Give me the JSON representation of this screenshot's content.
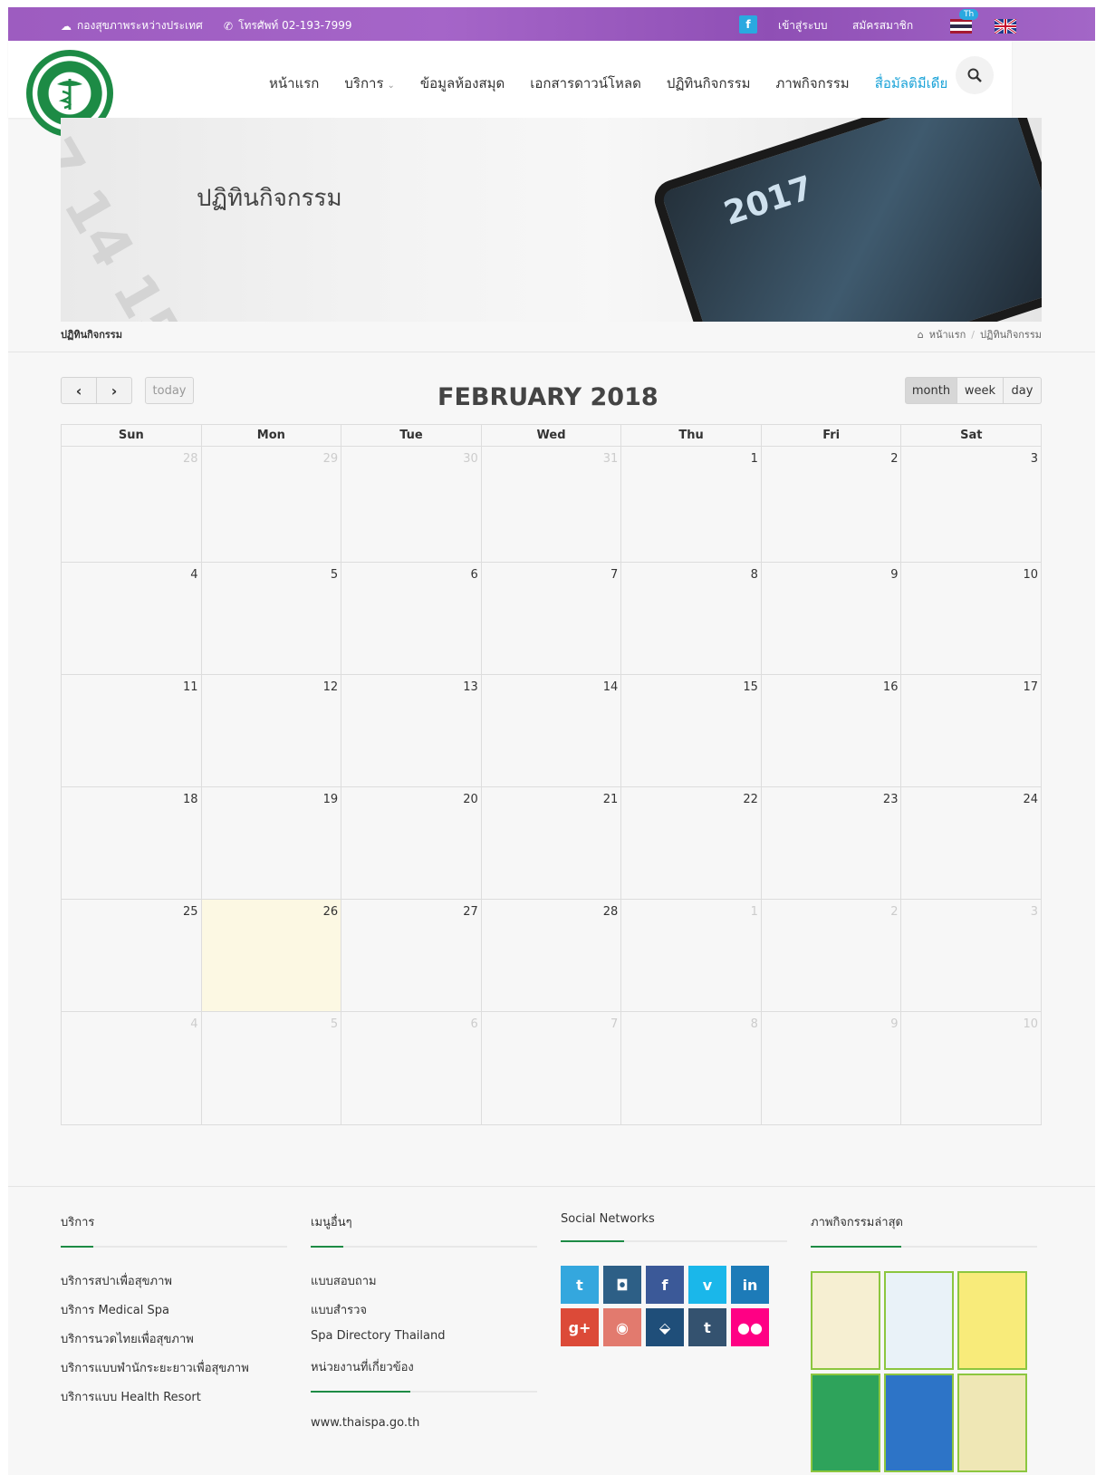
{
  "topbar": {
    "division": "กองสุขภาพระหว่างประเทศ",
    "phone": "โทรศัพท์ 02-193-7999",
    "facebook": "f",
    "login": "เข้าสู่ระบบ",
    "register": "สมัครสมาชิก",
    "lang_badge": "Th"
  },
  "header": {
    "nav": [
      {
        "label": "หน้าแรก"
      },
      {
        "label": "บริการ"
      },
      {
        "label": "ข้อมูลห้องสมุด"
      },
      {
        "label": "เอกสารดาวน์โหลด"
      },
      {
        "label": "ปฏิทินกิจกรรม"
      },
      {
        "label": "ภาพกิจกรรม"
      },
      {
        "label": "สื่อมัลติมีเดีย"
      }
    ],
    "active_color": "#1ba3d8"
  },
  "banner": {
    "title": "ปฏิทินกิจกรรม",
    "tablet_year": "2017"
  },
  "breadcrumb": {
    "page": "ปฏิทินกิจกรรม",
    "home": "หน้าแรก",
    "separator": "/",
    "current": "ปฏิทินกิจกรรม"
  },
  "calendar": {
    "title": "FEBRUARY 2018",
    "today_label": "today",
    "views": [
      "month",
      "week",
      "day"
    ],
    "active_view": "month",
    "weekdays": [
      "Sun",
      "Mon",
      "Tue",
      "Wed",
      "Thu",
      "Fri",
      "Sat"
    ],
    "weeks": [
      [
        {
          "d": "28",
          "o": true
        },
        {
          "d": "29",
          "o": true
        },
        {
          "d": "30",
          "o": true
        },
        {
          "d": "31",
          "o": true
        },
        {
          "d": "1"
        },
        {
          "d": "2"
        },
        {
          "d": "3"
        }
      ],
      [
        {
          "d": "4"
        },
        {
          "d": "5"
        },
        {
          "d": "6"
        },
        {
          "d": "7"
        },
        {
          "d": "8"
        },
        {
          "d": "9"
        },
        {
          "d": "10"
        }
      ],
      [
        {
          "d": "11"
        },
        {
          "d": "12"
        },
        {
          "d": "13"
        },
        {
          "d": "14"
        },
        {
          "d": "15"
        },
        {
          "d": "16"
        },
        {
          "d": "17"
        }
      ],
      [
        {
          "d": "18"
        },
        {
          "d": "19"
        },
        {
          "d": "20"
        },
        {
          "d": "21"
        },
        {
          "d": "22"
        },
        {
          "d": "23"
        },
        {
          "d": "24"
        }
      ],
      [
        {
          "d": "25"
        },
        {
          "d": "26",
          "t": true
        },
        {
          "d": "27"
        },
        {
          "d": "28"
        },
        {
          "d": "1",
          "o": true
        },
        {
          "d": "2",
          "o": true
        },
        {
          "d": "3",
          "o": true
        }
      ],
      [
        {
          "d": "4",
          "o": true
        },
        {
          "d": "5",
          "o": true
        },
        {
          "d": "6",
          "o": true
        },
        {
          "d": "7",
          "o": true
        },
        {
          "d": "8",
          "o": true
        },
        {
          "d": "9",
          "o": true
        },
        {
          "d": "10",
          "o": true
        }
      ]
    ]
  },
  "footer": {
    "services": {
      "title": "บริการ",
      "items": [
        "บริการสปาเพื่อสุขภาพ",
        "บริการ Medical Spa",
        "บริการนวดไทยเพื่อสุขภาพ",
        "บริการแบบพำนักระยะยาวเพื่อสุขภาพ",
        "บริการแบบ Health Resort"
      ]
    },
    "menu": {
      "title": "เมนูอื่นๆ",
      "items": [
        "แบบสอบถาม",
        "แบบสำรวจ",
        "Spa Directory Thailand"
      ],
      "related_title": "หน่วยงานที่เกี่ยวข้อง",
      "related_items": [
        "www.thaispa.go.th"
      ]
    },
    "social": {
      "title": "Social Networks",
      "buttons": [
        {
          "name": "twitter",
          "glyph": "t",
          "color": "#34a7de"
        },
        {
          "name": "instagram",
          "glyph": "◘",
          "color": "#2d5f86"
        },
        {
          "name": "facebook",
          "glyph": "f",
          "color": "#3b5998"
        },
        {
          "name": "vimeo",
          "glyph": "v",
          "color": "#1ab7ea"
        },
        {
          "name": "linkedin",
          "glyph": "in",
          "color": "#1d7bb8"
        },
        {
          "name": "google-plus",
          "glyph": "g+",
          "color": "#dc4a38"
        },
        {
          "name": "dribbble",
          "glyph": "◉",
          "color": "#e27a6e"
        },
        {
          "name": "foursquare",
          "glyph": "⬙",
          "color": "#1f4e79"
        },
        {
          "name": "tumblr",
          "glyph": "t",
          "color": "#34526f"
        },
        {
          "name": "flickr",
          "glyph": "●●",
          "color": "#ff0084"
        }
      ]
    },
    "gallery": {
      "title": "ภาพกิจกรรมล่าสุด",
      "thumb_colors": [
        "#f6efd2",
        "#e9f2f8",
        "#f8eb7a",
        "#2ea35b",
        "#2d74c7",
        "#efe7b5"
      ]
    }
  }
}
